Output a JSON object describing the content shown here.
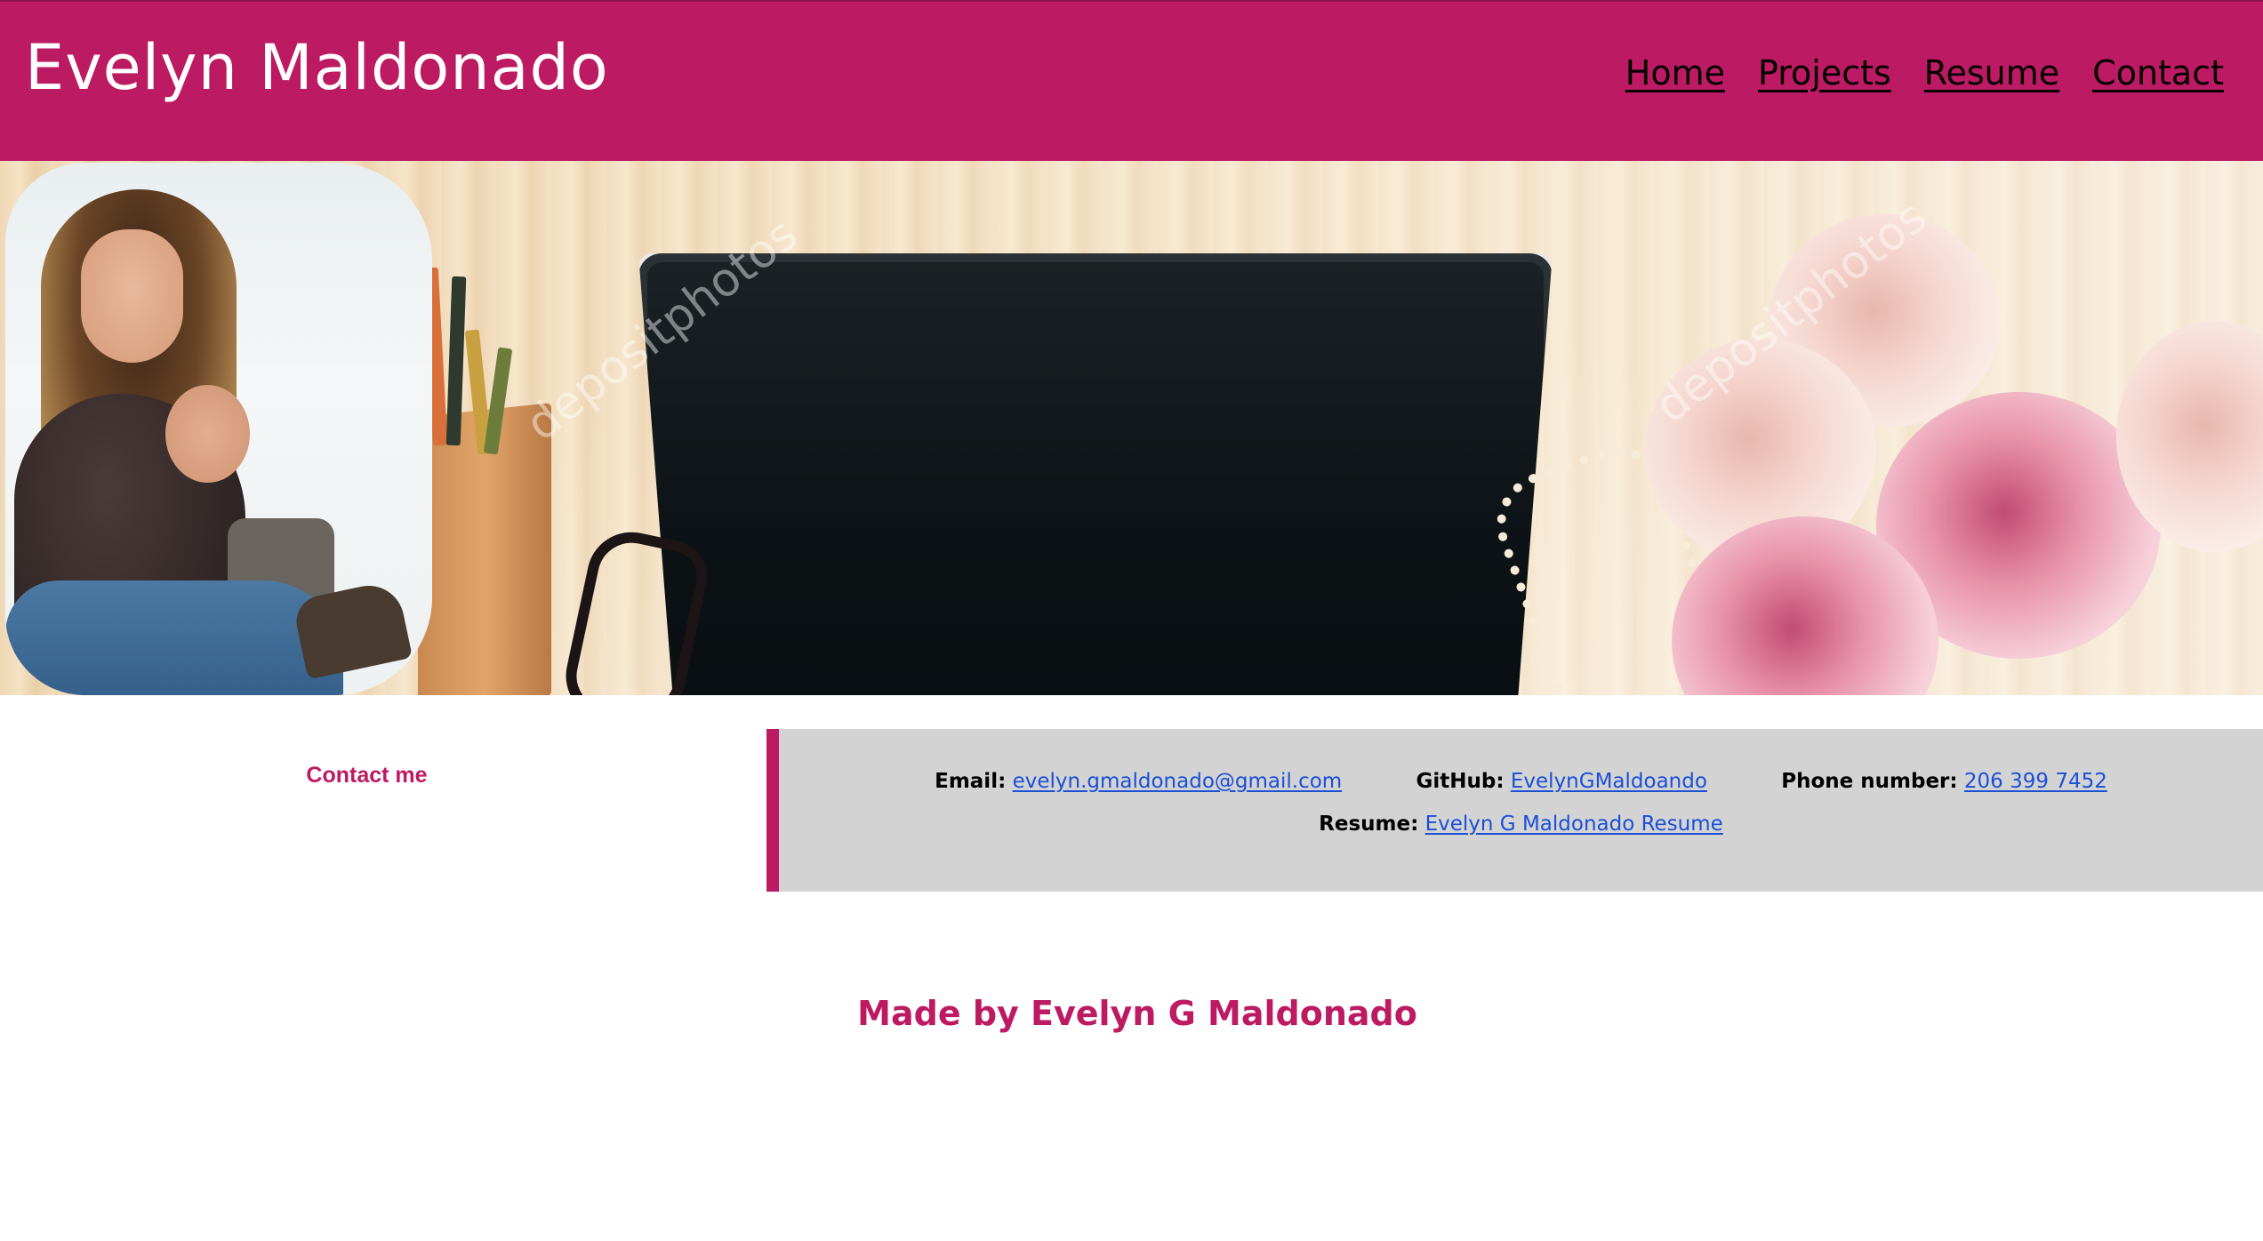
{
  "header": {
    "title": "Evelyn Maldonado",
    "nav": [
      {
        "label": "Home"
      },
      {
        "label": "Projects"
      },
      {
        "label": "Resume"
      },
      {
        "label": "Contact"
      }
    ]
  },
  "hero": {
    "watermark_text": "depositphotos"
  },
  "contact": {
    "section_label": "Contact me",
    "email": {
      "label": "Email:",
      "value": "evelyn.gmaldonado@gmail.com"
    },
    "github": {
      "label": "GitHub:",
      "value": "EvelynGMaldoando"
    },
    "phone": {
      "label": "Phone number:",
      "value": "206 399 7452"
    },
    "resume": {
      "label": "Resume:",
      "value": "Evelyn G Maldonado Resume"
    }
  },
  "footer": {
    "text": "Made by Evelyn G Maldonado"
  },
  "colors": {
    "brand": "#BC1A62",
    "contact_box": "#D3D3D3",
    "link": "#1a4fd6"
  }
}
